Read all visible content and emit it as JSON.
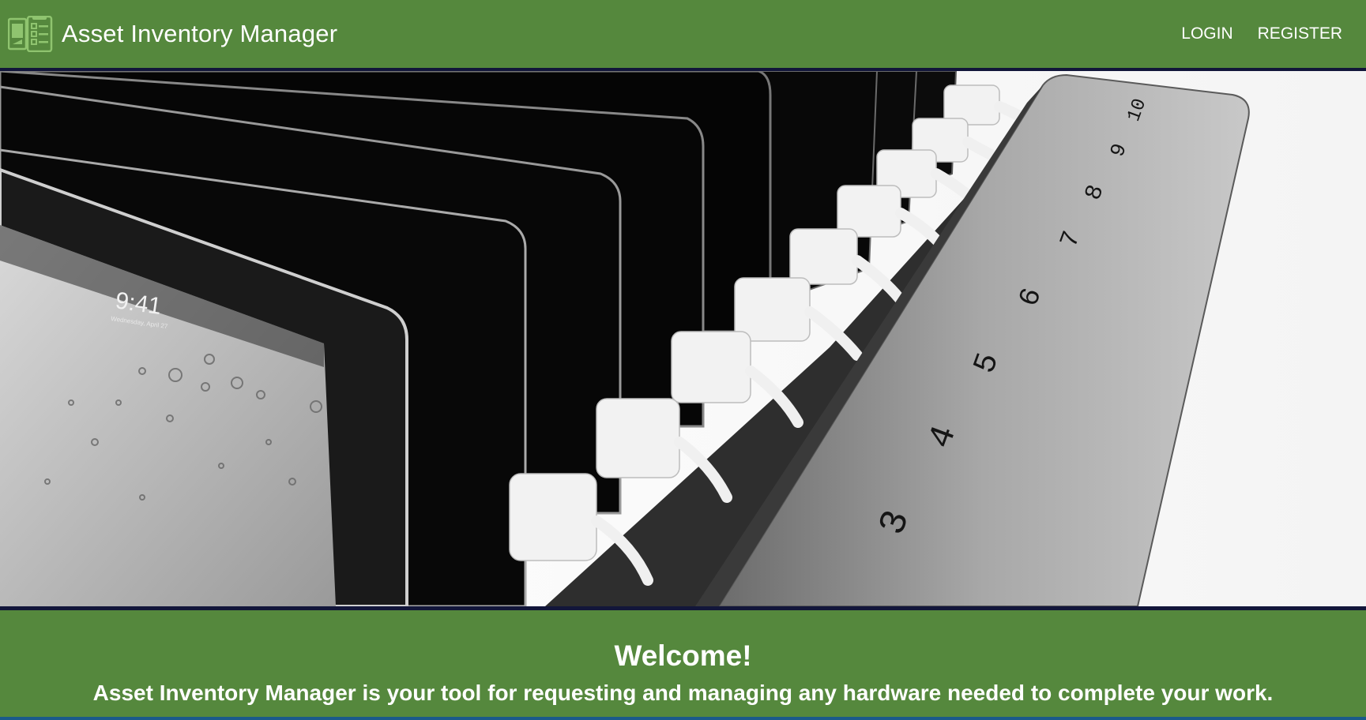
{
  "header": {
    "title": "Asset Inventory Manager",
    "logo_icon": "inventory-checklist-icon",
    "nav": {
      "login_label": "LOGIN",
      "register_label": "REGISTER"
    }
  },
  "hero": {
    "description_icon": "tablet-charging-station-photo",
    "screen_time": "9:41",
    "screen_date": "Wednesday, April 27",
    "slot_numbers": [
      "10",
      "9",
      "8",
      "7",
      "6",
      "5",
      "4",
      "3"
    ]
  },
  "welcome": {
    "title": "Welcome!",
    "text": "Asset Inventory Manager is your tool for requesting and managing any hardware needed to complete your work."
  },
  "colors": {
    "brand_green": "#55883d",
    "divider_navy": "#12163a"
  }
}
